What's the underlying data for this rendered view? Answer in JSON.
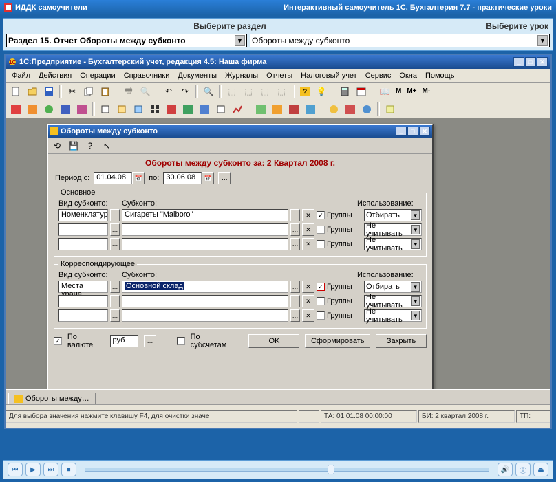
{
  "outer": {
    "title_left": "ИДДК самоучители",
    "title_right": "Интерактивный самоучитель 1С. Бухгалтерия 7.7 - практические уроки",
    "choose_section": "Выберите раздел",
    "choose_lesson": "Выберите урок",
    "section_value": "Раздел 15. Отчет Обороты между субконто",
    "lesson_value": "Обороты между субконто"
  },
  "app": {
    "title": "1С:Предприятие - Бухгалтерский учет, редакция 4.5: Наша фирма",
    "menu": [
      "Файл",
      "Действия",
      "Операции",
      "Справочники",
      "Документы",
      "Журналы",
      "Отчеты",
      "Налоговый учет",
      "Сервис",
      "Окна",
      "Помощь"
    ],
    "txtbtns": [
      "М",
      "М+",
      "М-"
    ]
  },
  "dialog": {
    "title": "Обороты между субконто",
    "heading": "Обороты между субконто за: 2 Квартал 2008 г.",
    "period_from_lbl": "Период с:",
    "period_from": "01.04.08",
    "period_to_lbl": "по:",
    "period_to": "30.06.08",
    "fieldset1": "Основное",
    "fieldset2": "Корреспондирующее",
    "head_kind": "Вид субконто:",
    "head_sub": "Субконто:",
    "head_use": "Использование:",
    "groups_lbl": "Группы",
    "use_pick": "Отбирать",
    "use_skip": "Не учитывать",
    "main_rows": [
      {
        "kind": "Номенклатур",
        "sub": "Сигареты \"Malboro\"",
        "grp": true,
        "use": "Отбирать"
      },
      {
        "kind": "",
        "sub": "",
        "grp": false,
        "use": "Не учитывать"
      },
      {
        "kind": "",
        "sub": "",
        "grp": false,
        "use": "Не учитывать"
      }
    ],
    "corr_rows": [
      {
        "kind": "Места хране",
        "sub": "Основной склад",
        "grp": true,
        "use": "Отбирать",
        "hl": true
      },
      {
        "kind": "",
        "sub": "",
        "grp": false,
        "use": "Не учитывать"
      },
      {
        "kind": "",
        "sub": "",
        "grp": false,
        "use": "Не учитывать"
      }
    ],
    "by_currency_lbl": "По валюте",
    "currency": "руб",
    "by_subacc_lbl": "По субсчетам",
    "btn_ok": "OK",
    "btn_form": "Сформировать",
    "btn_close": "Закрыть"
  },
  "tab": "Обороты между…",
  "status": {
    "hint": "Для выбора значения нажмите клавишу F4, для очистки значе",
    "ta": "ТА: 01.01.08  00:00:00",
    "bi": "БИ: 2 квартал 2008 г.",
    "tp": "ТП:"
  }
}
